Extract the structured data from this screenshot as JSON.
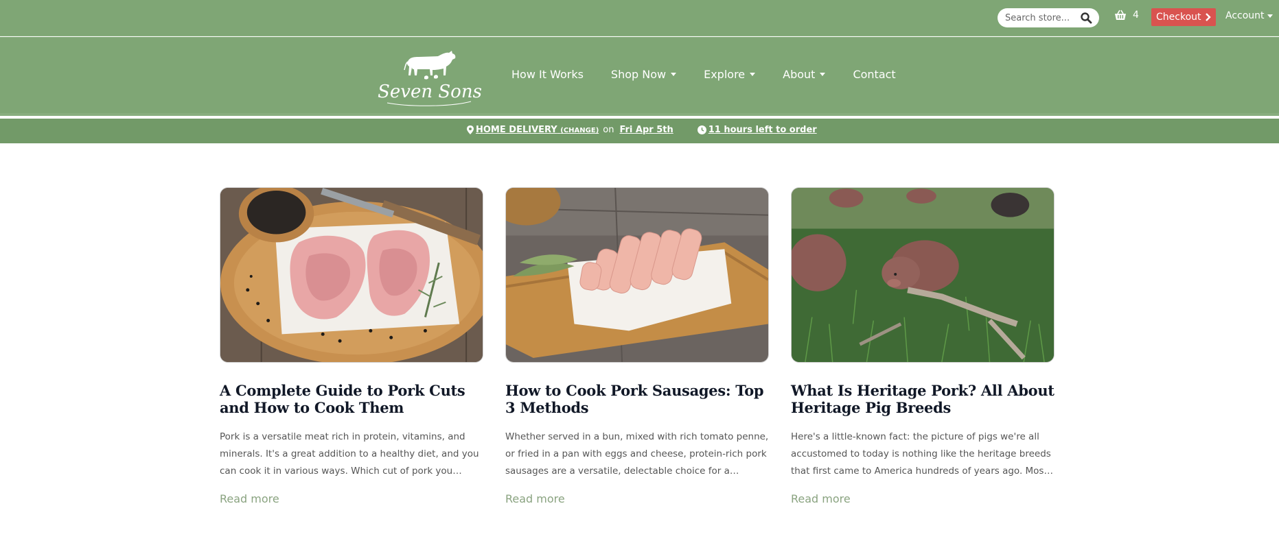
{
  "colors": {
    "header_green": "#7fa675",
    "delivery_green": "#729a68",
    "checkout_red": "#d9534f",
    "read_more_green": "#8aa380"
  },
  "topbar": {
    "search_placeholder": "Search store...",
    "search_icon": "magnifier-icon",
    "cart_icon": "basket-icon",
    "cart_count": "4",
    "checkout_label": "Checkout",
    "account_label": "Account"
  },
  "header": {
    "logo_text": "Seven Sons",
    "nav": [
      {
        "label": "How It Works",
        "dropdown": false
      },
      {
        "label": "Shop Now",
        "dropdown": true
      },
      {
        "label": "Explore",
        "dropdown": true
      },
      {
        "label": "About",
        "dropdown": true
      },
      {
        "label": "Contact",
        "dropdown": false
      }
    ]
  },
  "delivery": {
    "method": "HOME DELIVERY",
    "change_label": "(CHANGE)",
    "on_label": "on",
    "date": "Fri Apr 5th",
    "time_left": "11 hours left to order"
  },
  "articles": [
    {
      "title": "A Complete Guide to Pork Cuts and How to Cook Them",
      "excerpt": "Pork is a versatile meat rich in protein, vitamins, and minerals. It's a great addition to a healthy diet, and you can cook it in various ways. Which cut of pork you choose...",
      "read_more": "Read more"
    },
    {
      "title": "How to Cook Pork Sausages: Top 3 Methods",
      "excerpt": "Whether served in a bun, mixed with rich tomato penne, or fried in a pan with eggs and cheese, protein-rich pork sausages are a versatile, delectable choice for a flavor-...",
      "read_more": "Read more"
    },
    {
      "title": "What Is Heritage Pork? All About Heritage Pig Breeds",
      "excerpt": "Here's a little-known fact: the picture of pigs we're all accustomed to today is nothing like the heritage breeds that first came to America hundreds of years ago.  Most ...",
      "read_more": "Read more"
    }
  ]
}
